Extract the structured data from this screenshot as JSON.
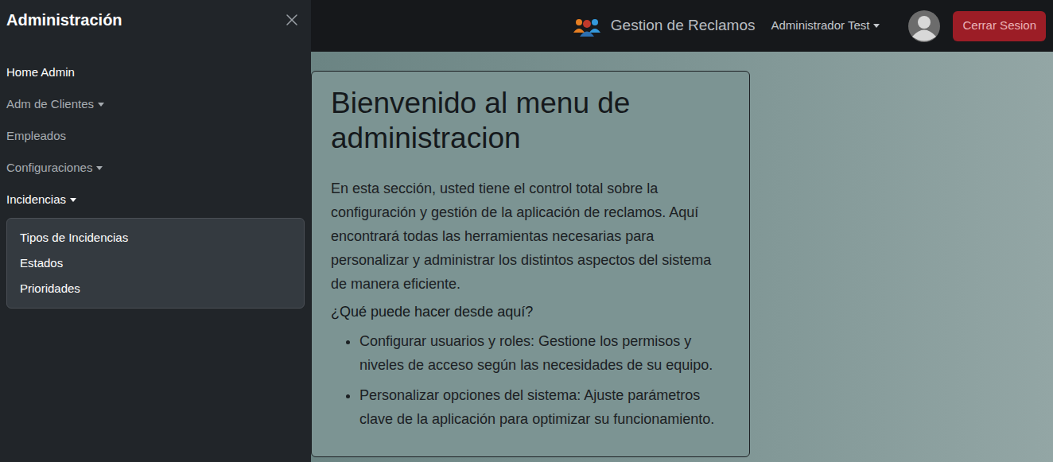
{
  "sidebar": {
    "title": "Administración",
    "items": [
      {
        "label": "Home Admin",
        "kind": "link",
        "selected": true,
        "expanded": false,
        "children": []
      },
      {
        "label": "Adm de Clientes",
        "kind": "dropdown",
        "selected": false,
        "expanded": false,
        "children": []
      },
      {
        "label": "Empleados",
        "kind": "link",
        "selected": false,
        "expanded": false,
        "children": []
      },
      {
        "label": "Configuraciones",
        "kind": "dropdown",
        "selected": false,
        "expanded": false,
        "children": []
      },
      {
        "label": "Incidencias",
        "kind": "dropdown",
        "selected": false,
        "expanded": true,
        "children": [
          "Tipos de Incidencias",
          "Estados",
          "Prioridades"
        ]
      }
    ]
  },
  "navbar": {
    "brand": "Gestion de Reclamos",
    "user": "Administrador Test",
    "logout": "Cerrar Sesion"
  },
  "card": {
    "title": "Bienvenido al menu de administracion",
    "intro": "En esta sección, usted tiene el control total sobre la configuración y gestión de la aplicación de reclamos. Aquí encontrará todas las herramientas necesarias para personalizar y administrar los distintos aspectos del sistema de manera eficiente.",
    "subtitle": "¿Qué puede hacer desde aquí?",
    "bullets": [
      "Configurar usuarios y roles: Gestione los permisos y niveles de acceso según las necesidades de su equipo.",
      "Personalizar opciones del sistema: Ajuste parámetros clave de la aplicación para optimizar su funcionamiento."
    ]
  }
}
